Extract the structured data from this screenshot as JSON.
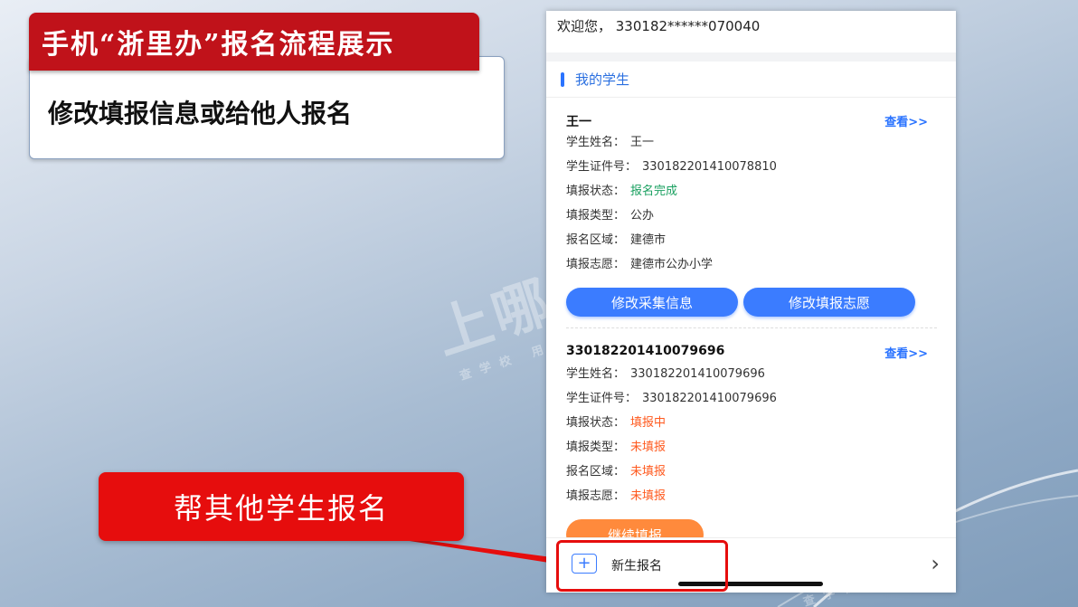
{
  "slide": {
    "title": "手机“浙里办”报名流程展示",
    "subtitle": "修改填报信息或给他人报名",
    "callout": "帮其他学生报名",
    "watermark": {
      "text": "上哪学",
      "tagline": "查学校 用上哪学"
    }
  },
  "phone": {
    "welcome": "欢迎您， 330182******070040",
    "section_title": "我的学生",
    "view_label": "查看>>",
    "students": [
      {
        "header": "王一",
        "rows": [
          {
            "label": "学生姓名：",
            "value": "王一",
            "status": "normal"
          },
          {
            "label": "学生证件号：",
            "value": "330182201410078810",
            "status": "normal"
          },
          {
            "label": "填报状态：",
            "value": "报名完成",
            "status": "ok"
          },
          {
            "label": "填报类型：",
            "value": "公办",
            "status": "normal"
          },
          {
            "label": "报名区域：",
            "value": "建德市",
            "status": "normal"
          },
          {
            "label": "填报志愿：",
            "value": "建德市公办小学",
            "status": "normal"
          }
        ],
        "buttons": [
          "修改采集信息",
          "修改填报志愿"
        ]
      },
      {
        "header": "330182201410079696",
        "rows": [
          {
            "label": "学生姓名：",
            "value": "330182201410079696",
            "status": "normal"
          },
          {
            "label": "学生证件号：",
            "value": "330182201410079696",
            "status": "normal"
          },
          {
            "label": "填报状态：",
            "value": "填报中",
            "status": "warn"
          },
          {
            "label": "填报类型：",
            "value": "未填报",
            "status": "warn"
          },
          {
            "label": "报名区域：",
            "value": "未填报",
            "status": "warn"
          },
          {
            "label": "填报志愿：",
            "value": "未填报",
            "status": "warn"
          }
        ],
        "buttons": [
          "继续填报"
        ]
      }
    ],
    "bottom_bar": {
      "plus_icon": "+",
      "label": "新生报名",
      "chevron": "›"
    }
  },
  "colors": {
    "title_red": "#c0121a",
    "callout_red": "#e60d0d",
    "accent_blue": "#2a73ff",
    "status_ok": "#1aa060",
    "status_warn": "#ff5a1f",
    "continue_orange": "#ff8a3c"
  }
}
